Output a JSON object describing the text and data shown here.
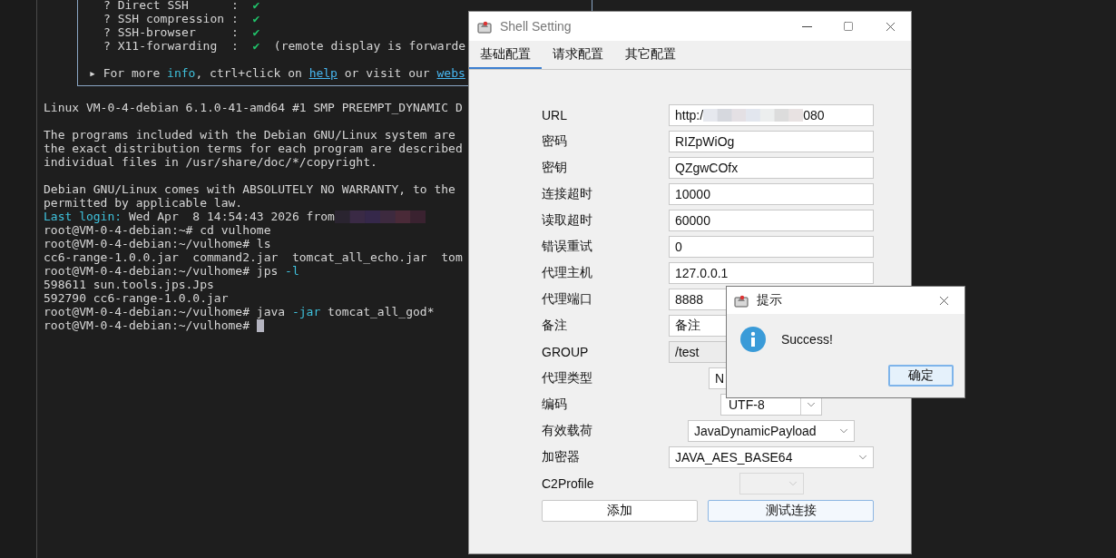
{
  "terminal": {
    "box": {
      "paragraphs": [
        {
          "kind": "list",
          "lines": [
            {
              "segments": [
                {
                  "kind": "plain",
                  "text": "? Direct SSH      :  "
                },
                {
                  "kind": "check",
                  "text": "✔"
                }
              ]
            },
            {
              "segments": [
                {
                  "kind": "plain",
                  "text": "? SSH compression :  "
                },
                {
                  "kind": "check",
                  "text": "✔"
                }
              ]
            },
            {
              "segments": [
                {
                  "kind": "plain",
                  "text": "? SSH-browser     :  "
                },
                {
                  "kind": "check",
                  "text": "✔"
                }
              ]
            },
            {
              "segments": [
                {
                  "kind": "plain",
                  "text": "? X11-forwarding  :  "
                },
                {
                  "kind": "check",
                  "text": "✔"
                },
                {
                  "kind": "plain",
                  "text": "  (remote display is forwarde"
                }
              ]
            }
          ]
        },
        {
          "kind": "note",
          "lines": [
            {
              "segments": [
                {
                  "kind": "plain",
                  "text": "▸ For more "
                },
                {
                  "kind": "accent",
                  "text": "info"
                },
                {
                  "kind": "plain",
                  "text": ", ctrl+click on "
                },
                {
                  "kind": "link",
                  "text": "help"
                },
                {
                  "kind": "plain",
                  "text": " or visit our "
                },
                {
                  "kind": "link",
                  "text": "webs"
                }
              ]
            }
          ]
        }
      ]
    },
    "paragraphs": [
      [
        {
          "segments": [
            {
              "kind": "plain",
              "text": "Linux VM-0-4-debian 6.1.0-41-amd64 #1 SMP PREEMPT_DYNAMIC D"
            }
          ]
        }
      ],
      [
        {
          "segments": [
            {
              "kind": "plain",
              "text": "The programs included with the Debian GNU/Linux system are"
            }
          ]
        },
        {
          "segments": [
            {
              "kind": "plain",
              "text": "the exact distribution terms for each program are described"
            }
          ]
        },
        {
          "segments": [
            {
              "kind": "plain",
              "text": "individual files in /usr/share/doc/*/copyright."
            }
          ]
        }
      ],
      [
        {
          "segments": [
            {
              "kind": "plain",
              "text": "Debian GNU/Linux comes with ABSOLUTELY NO WARRANTY, to the"
            }
          ]
        },
        {
          "segments": [
            {
              "kind": "plain",
              "text": "permitted by applicable law."
            }
          ]
        },
        {
          "segments": [
            {
              "kind": "accent",
              "text": "Last login:"
            },
            {
              "kind": "plain",
              "text": " Wed Apr  8 14:54:43 2026 from"
            },
            {
              "kind": "redacted"
            }
          ]
        },
        {
          "segments": [
            {
              "kind": "plain",
              "text": "root@VM-0-4-debian:~# cd vulhome"
            }
          ]
        },
        {
          "segments": [
            {
              "kind": "plain",
              "text": "root@VM-0-4-debian:~/vulhome# ls"
            }
          ]
        },
        {
          "segments": [
            {
              "kind": "plain",
              "text": "cc6-range-1.0.0.jar  command2.jar  tomcat_all_echo.jar  tom"
            }
          ]
        },
        {
          "segments": [
            {
              "kind": "plain",
              "text": "root@VM-0-4-debian:~/vulhome# jps "
            },
            {
              "kind": "accent",
              "text": "-l"
            }
          ]
        },
        {
          "segments": [
            {
              "kind": "plain",
              "text": "598611 sun.tools.jps.Jps"
            }
          ]
        },
        {
          "segments": [
            {
              "kind": "plain",
              "text": "592790 cc6-range-1.0.0.jar"
            }
          ]
        },
        {
          "segments": [
            {
              "kind": "plain",
              "text": "root@VM-0-4-debian:~/vulhome# java "
            },
            {
              "kind": "accent",
              "text": "-jar"
            },
            {
              "kind": "plain",
              "text": " tomcat_all_god*"
            }
          ]
        },
        {
          "cursor": true,
          "segments": [
            {
              "kind": "plain",
              "text": "root@VM-0-4-debian:~/vulhome# "
            }
          ]
        }
      ]
    ]
  },
  "shell_setting": {
    "title": "Shell Setting",
    "tabs": [
      {
        "label": "基础配置",
        "selected": true
      },
      {
        "label": "请求配置",
        "selected": false
      },
      {
        "label": "其它配置",
        "selected": false
      }
    ],
    "rows": [
      {
        "kind": "text",
        "label": "URL",
        "value": "http:/",
        "redacted": true,
        "value_after_redaction": "080",
        "disabled": false
      },
      {
        "kind": "text",
        "label": "密码",
        "value": "RIZpWiOg",
        "disabled": false
      },
      {
        "kind": "text",
        "label": "密钥",
        "value": "QZgwCOfx",
        "disabled": false
      },
      {
        "kind": "text",
        "label": "连接超时",
        "value": "10000",
        "disabled": false
      },
      {
        "kind": "text",
        "label": "读取超时",
        "value": "60000",
        "disabled": false
      },
      {
        "kind": "text",
        "label": "错误重试",
        "value": "0",
        "disabled": false
      },
      {
        "kind": "text",
        "label": "代理主机",
        "value": "127.0.0.1",
        "disabled": false
      },
      {
        "kind": "text",
        "label": "代理端口",
        "value": "8888",
        "disabled": false
      },
      {
        "kind": "text",
        "label": "备注",
        "value": "备注",
        "disabled": false
      },
      {
        "kind": "text",
        "label": "GROUP",
        "value": "/test",
        "disabled": true
      },
      {
        "kind": "combo",
        "label": "代理类型",
        "value": "N",
        "editable": false,
        "disabled": false
      },
      {
        "kind": "combo",
        "label": "编码",
        "value": "UTF-8",
        "editable": true,
        "disabled": false
      },
      {
        "kind": "combo",
        "label": "有效载荷",
        "value": "JavaDynamicPayload",
        "editable": false,
        "disabled": false
      },
      {
        "kind": "combo",
        "label": "加密器",
        "value": "JAVA_AES_BASE64",
        "editable": false,
        "disabled": false
      },
      {
        "kind": "combo",
        "label": "C2Profile",
        "editable": false,
        "disabled": true
      }
    ],
    "buttons": [
      {
        "label": "添加",
        "focused": false
      },
      {
        "label": "测试连接",
        "focused": true
      }
    ]
  },
  "message_box": {
    "title": "提示",
    "message": "Success!",
    "button": "确定"
  }
}
